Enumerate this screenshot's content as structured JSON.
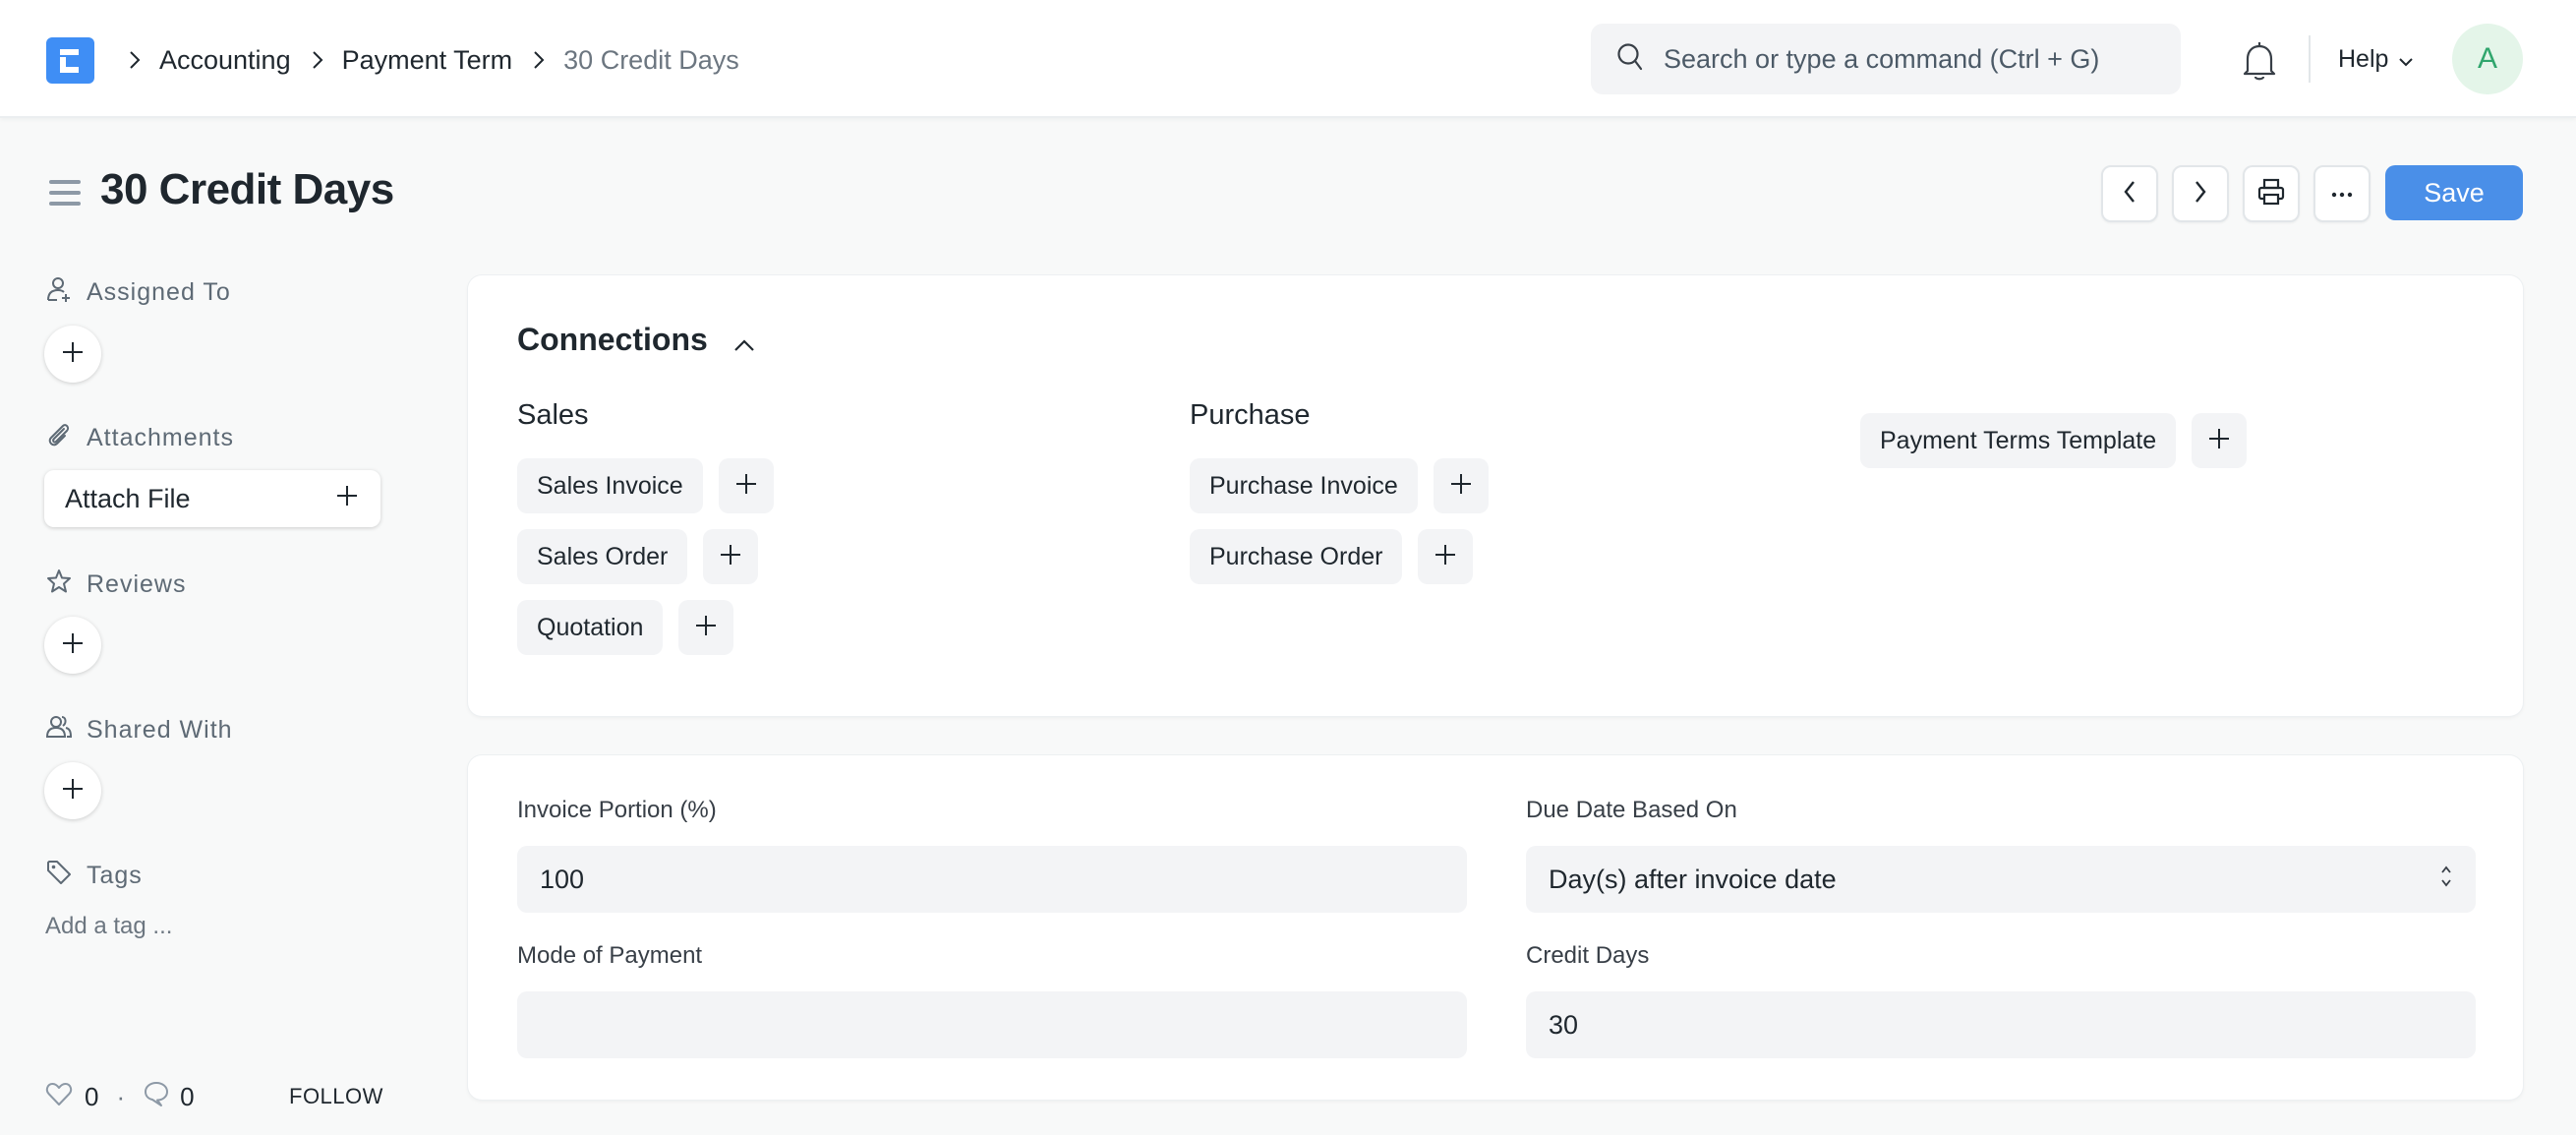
{
  "navbar": {
    "logo_letter": "E",
    "breadcrumbs": [
      {
        "label": "Accounting"
      },
      {
        "label": "Payment Term"
      },
      {
        "label": "30 Credit Days"
      }
    ],
    "search_placeholder": "Search or type a command (Ctrl + G)",
    "help_label": "Help",
    "avatar_initial": "A"
  },
  "page": {
    "title": "30 Credit Days",
    "save_label": "Save"
  },
  "sidebar": {
    "assigned_to": "Assigned To",
    "attachments": "Attachments",
    "attach_file": "Attach File",
    "reviews": "Reviews",
    "shared_with": "Shared With",
    "tags": "Tags",
    "add_tag": "Add a tag ...",
    "likes": "0",
    "separator": "·",
    "comments": "0",
    "follow": "FOLLOW"
  },
  "connections": {
    "title": "Connections",
    "groups": [
      {
        "title": "Sales",
        "items": [
          "Sales Invoice",
          "Sales Order",
          "Quotation"
        ]
      },
      {
        "title": "Purchase",
        "items": [
          "Purchase Invoice",
          "Purchase Order"
        ]
      },
      {
        "title": "",
        "items": [
          "Payment Terms Template"
        ]
      }
    ]
  },
  "form": {
    "invoice_portion": {
      "label": "Invoice Portion (%)",
      "value": "100"
    },
    "due_date_based_on": {
      "label": "Due Date Based On",
      "value": "Day(s) after invoice date"
    },
    "mode_of_payment": {
      "label": "Mode of Payment",
      "value": ""
    },
    "credit_days": {
      "label": "Credit Days",
      "value": "30"
    }
  },
  "colors": {
    "primary": "#4a8fe8",
    "logo": "#3f8ef5",
    "avatar_bg": "#e4f5e9",
    "avatar_fg": "#30a66d",
    "page_bg": "#f8f9f9",
    "input_bg": "#f3f4f6"
  }
}
